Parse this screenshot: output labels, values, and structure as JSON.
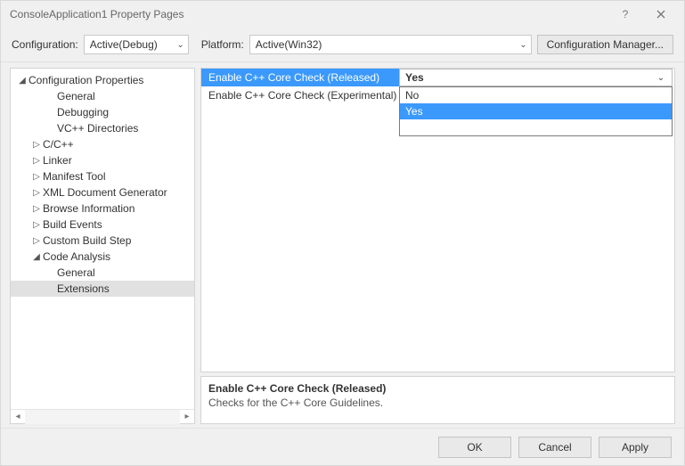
{
  "window": {
    "title": "ConsoleApplication1 Property Pages"
  },
  "toolbar": {
    "configuration_label": "Configuration:",
    "configuration_value": "Active(Debug)",
    "platform_label": "Platform:",
    "platform_value": "Active(Win32)",
    "config_manager_label": "Configuration Manager..."
  },
  "tree": {
    "root": "Configuration Properties",
    "items": [
      {
        "label": "General",
        "indent": 2,
        "caret": ""
      },
      {
        "label": "Debugging",
        "indent": 2,
        "caret": ""
      },
      {
        "label": "VC++ Directories",
        "indent": 2,
        "caret": ""
      },
      {
        "label": "C/C++",
        "indent": 1,
        "caret": "▷"
      },
      {
        "label": "Linker",
        "indent": 1,
        "caret": "▷"
      },
      {
        "label": "Manifest Tool",
        "indent": 1,
        "caret": "▷"
      },
      {
        "label": "XML Document Generator",
        "indent": 1,
        "caret": "▷"
      },
      {
        "label": "Browse Information",
        "indent": 1,
        "caret": "▷"
      },
      {
        "label": "Build Events",
        "indent": 1,
        "caret": "▷"
      },
      {
        "label": "Custom Build Step",
        "indent": 1,
        "caret": "▷"
      },
      {
        "label": "Code Analysis",
        "indent": 1,
        "caret": "◢"
      },
      {
        "label": "General",
        "indent": 2,
        "caret": ""
      },
      {
        "label": "Extensions",
        "indent": 2,
        "caret": "",
        "selected": true
      }
    ]
  },
  "grid": {
    "rows": [
      {
        "name": "Enable C++ Core Check (Released)",
        "value": "Yes",
        "selected": true
      },
      {
        "name": "Enable C++ Core Check (Experimental)",
        "value": ""
      }
    ],
    "dropdown": {
      "options": [
        "No",
        "Yes"
      ],
      "highlighted": "Yes"
    }
  },
  "description": {
    "title": "Enable C++ Core Check (Released)",
    "text": "Checks for the C++ Core Guidelines."
  },
  "footer": {
    "ok": "OK",
    "cancel": "Cancel",
    "apply": "Apply"
  }
}
